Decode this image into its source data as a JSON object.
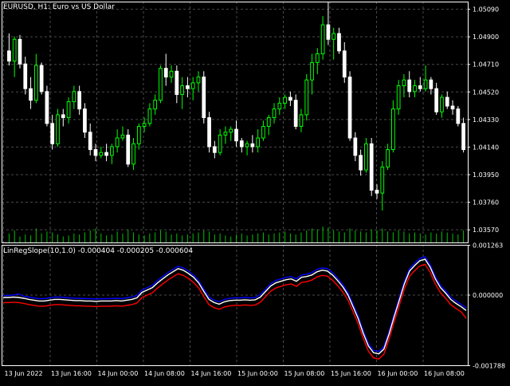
{
  "title": "EURUSD, H1:  Euro vs US Dollar",
  "indicator_label": "LinRegSlope(10,1.0) -0.000404 -0.000205 -0.000604",
  "colors": {
    "background": "#000000",
    "grid": "#4a4a4a",
    "candle_bull": "#00ff00",
    "candle_bear": "#ffffff",
    "volume": "#00c000",
    "line_main": "#ffffff",
    "line_upper": "#0000ff",
    "line_lower": "#ff0000",
    "text": "#ffffff"
  },
  "chart_data": [
    {
      "type": "candlestick",
      "title": "EURUSD, H1:  Euro vs US Dollar",
      "price_ticks": [
        "1.05090",
        "1.04900",
        "1.04710",
        "1.04520",
        "1.04330",
        "1.04140",
        "1.03950",
        "1.03760",
        "1.03570"
      ],
      "ylim": [
        1.0348,
        1.0514
      ],
      "grid": true,
      "x_ticks": [
        "13 Jun 2022",
        "13 Jun 16:00",
        "14 Jun 00:00",
        "14 Jun 08:00",
        "14 Jun 16:00",
        "15 Jun 00:00",
        "15 Jun 08:00",
        "15 Jun 16:00",
        "16 Jun 00:00",
        "16 Jun 08:00"
      ],
      "ohlc": [
        [
          1.048,
          1.0492,
          1.047,
          1.0473
        ],
        [
          1.0473,
          1.049,
          1.0462,
          1.0488
        ],
        [
          1.0488,
          1.0491,
          1.0468,
          1.0471
        ],
        [
          1.0471,
          1.0476,
          1.045,
          1.0454
        ],
        [
          1.0454,
          1.0462,
          1.044,
          1.0446
        ],
        [
          1.0446,
          1.0478,
          1.0444,
          1.047
        ],
        [
          1.047,
          1.0472,
          1.045,
          1.0452
        ],
        [
          1.0452,
          1.0456,
          1.0428,
          1.043
        ],
        [
          1.043,
          1.0436,
          1.0412,
          1.0416
        ],
        [
          1.0416,
          1.044,
          1.0414,
          1.0436
        ],
        [
          1.0436,
          1.044,
          1.0428,
          1.0434
        ],
        [
          1.0434,
          1.0448,
          1.043,
          1.0445
        ],
        [
          1.0445,
          1.0456,
          1.044,
          1.0452
        ],
        [
          1.0452,
          1.0456,
          1.0436,
          1.044
        ],
        [
          1.044,
          1.0444,
          1.042,
          1.0424
        ],
        [
          1.0424,
          1.043,
          1.0408,
          1.0412
        ],
        [
          1.0412,
          1.0416,
          1.0404,
          1.0408
        ],
        [
          1.0408,
          1.0414,
          1.0406,
          1.041
        ],
        [
          1.041,
          1.0416,
          1.0404,
          1.0408
        ],
        [
          1.0408,
          1.0416,
          1.0402,
          1.0414
        ],
        [
          1.0414,
          1.0426,
          1.041,
          1.042
        ],
        [
          1.042,
          1.0428,
          1.0418,
          1.0422
        ],
        [
          1.0422,
          1.0426,
          1.04,
          1.0402
        ],
        [
          1.0402,
          1.042,
          1.0398,
          1.0416
        ],
        [
          1.0416,
          1.043,
          1.0412,
          1.0428
        ],
        [
          1.0428,
          1.0434,
          1.0424,
          1.043
        ],
        [
          1.043,
          1.0444,
          1.0428,
          1.044
        ],
        [
          1.044,
          1.045,
          1.0436,
          1.0446
        ],
        [
          1.0446,
          1.047,
          1.0444,
          1.0468
        ],
        [
          1.0468,
          1.0478,
          1.0456,
          1.0462
        ],
        [
          1.0462,
          1.047,
          1.0458,
          1.0466
        ],
        [
          1.0466,
          1.047,
          1.0444,
          1.045
        ],
        [
          1.045,
          1.0462,
          1.044,
          1.0456
        ],
        [
          1.0456,
          1.0462,
          1.0448,
          1.0454
        ],
        [
          1.0454,
          1.0462,
          1.0446,
          1.0458
        ],
        [
          1.0458,
          1.0466,
          1.0452,
          1.0462
        ],
        [
          1.0462,
          1.0466,
          1.043,
          1.0434
        ],
        [
          1.0434,
          1.0438,
          1.041,
          1.0414
        ],
        [
          1.0414,
          1.0418,
          1.0406,
          1.041
        ],
        [
          1.041,
          1.0426,
          1.0408,
          1.0422
        ],
        [
          1.0422,
          1.0428,
          1.0416,
          1.0424
        ],
        [
          1.0424,
          1.0428,
          1.0418,
          1.0426
        ],
        [
          1.0426,
          1.0432,
          1.0414,
          1.0418
        ],
        [
          1.0418,
          1.042,
          1.041,
          1.0414
        ],
        [
          1.0414,
          1.0418,
          1.0408,
          1.0416
        ],
        [
          1.0416,
          1.0422,
          1.041,
          1.0414
        ],
        [
          1.0414,
          1.0426,
          1.041,
          1.042
        ],
        [
          1.042,
          1.0432,
          1.0418,
          1.0428
        ],
        [
          1.0428,
          1.0436,
          1.0422,
          1.0434
        ],
        [
          1.0434,
          1.0444,
          1.043,
          1.044
        ],
        [
          1.044,
          1.0448,
          1.0436,
          1.0444
        ],
        [
          1.0444,
          1.045,
          1.044,
          1.0448
        ],
        [
          1.0448,
          1.0452,
          1.0442,
          1.0446
        ],
        [
          1.0446,
          1.045,
          1.0426,
          1.0428
        ],
        [
          1.0428,
          1.044,
          1.0424,
          1.0436
        ],
        [
          1.0436,
          1.0464,
          1.0432,
          1.046
        ],
        [
          1.046,
          1.0478,
          1.045,
          1.0472
        ],
        [
          1.0472,
          1.0482,
          1.0464,
          1.0478
        ],
        [
          1.0478,
          1.0504,
          1.0474,
          1.0498
        ],
        [
          1.0498,
          1.0514,
          1.0484,
          1.0488
        ],
        [
          1.0488,
          1.0496,
          1.0474,
          1.0492
        ],
        [
          1.0492,
          1.0496,
          1.0478,
          1.048
        ],
        [
          1.048,
          1.0486,
          1.0458,
          1.0462
        ],
        [
          1.0462,
          1.0466,
          1.0418,
          1.042
        ],
        [
          1.042,
          1.0424,
          1.0404,
          1.0408
        ],
        [
          1.0408,
          1.0412,
          1.0394,
          1.0398
        ],
        [
          1.0398,
          1.042,
          1.0396,
          1.0416
        ],
        [
          1.0416,
          1.042,
          1.038,
          1.0384
        ],
        [
          1.0384,
          1.0388,
          1.0378,
          1.0382
        ],
        [
          1.0382,
          1.0404,
          1.037,
          1.04
        ],
        [
          1.04,
          1.0416,
          1.0398,
          1.0412
        ],
        [
          1.0412,
          1.0446,
          1.041,
          1.044
        ],
        [
          1.044,
          1.046,
          1.0436,
          1.0456
        ],
        [
          1.0456,
          1.0464,
          1.0448,
          1.046
        ],
        [
          1.046,
          1.0466,
          1.0448,
          1.0452
        ],
        [
          1.0452,
          1.046,
          1.0448,
          1.0456
        ],
        [
          1.0456,
          1.0462,
          1.0452,
          1.0454
        ],
        [
          1.0454,
          1.047,
          1.0452,
          1.046
        ],
        [
          1.046,
          1.0462,
          1.045,
          1.0454
        ],
        [
          1.0454,
          1.0458,
          1.0436,
          1.0438
        ],
        [
          1.0438,
          1.045,
          1.0434,
          1.0448
        ],
        [
          1.0448,
          1.0452,
          1.044,
          1.0442
        ],
        [
          1.0442,
          1.0446,
          1.0436,
          1.044
        ],
        [
          1.044,
          1.0442,
          1.0428,
          1.043
        ],
        [
          1.043,
          1.0434,
          1.041,
          1.0412
        ]
      ],
      "volume": [
        9,
        12,
        6,
        8,
        7,
        14,
        9,
        11,
        10,
        8,
        6,
        7,
        9,
        8,
        10,
        12,
        14,
        9,
        7,
        8,
        11,
        9,
        13,
        10,
        8,
        7,
        9,
        10,
        12,
        11,
        8,
        9,
        7,
        8,
        9,
        10,
        12,
        11,
        8,
        9,
        7,
        6,
        8,
        9,
        7,
        8,
        9,
        10,
        8,
        9,
        10,
        11,
        9,
        8,
        10,
        12,
        14,
        13,
        16,
        15,
        12,
        11,
        10,
        14,
        12,
        11,
        10,
        13,
        12,
        14,
        11,
        10,
        12,
        11,
        9,
        10,
        9,
        8,
        10,
        9,
        11,
        10,
        9,
        8,
        12
      ]
    },
    {
      "type": "line",
      "title": "LinRegSlope(10,1.0) -0.000404 -0.000205 -0.000604",
      "y_ticks": [
        "0.001263",
        "0.000000",
        "-0.001788"
      ],
      "ylim": [
        -0.001788,
        0.001263
      ],
      "series": [
        {
          "values": [
            -7e-05,
            -7e-05,
            -6e-05,
            -7e-05,
            -9e-05,
            -0.00012,
            -0.00014,
            -0.00016,
            -0.00016,
            -0.00014,
            -0.00012,
            -0.00012,
            -0.00013,
            -0.00014,
            -0.00015,
            -0.00015,
            -0.00016,
            -0.00016,
            -0.00017,
            -0.00016,
            -0.00016,
            -0.00016,
            -0.00015,
            -0.00016,
            -0.00014,
            -0.00012,
            -8e-05,
            6e-05,
            0.00012,
            0.00018,
            0.0003,
            0.0004,
            0.0005,
            0.00058,
            0.00066,
            0.00062,
            0.00054,
            0.00044,
            0.0003,
            8e-05,
            -0.00012,
            -0.0002,
            -0.00024,
            -0.00018,
            -0.00015,
            -0.00014,
            -0.00014,
            -0.00013,
            -0.00014,
            -0.00013,
            -6e-05,
            8e-05,
            0.00022,
            0.0003,
            0.00034,
            0.00038,
            0.0004,
            0.00034,
            0.00044,
            0.00046,
            0.0005,
            0.00058,
            0.00062,
            0.0006,
            0.0005,
            0.00036,
            0.0002,
            0.0,
            -0.0003,
            -0.0006,
            -0.00098,
            -0.0013,
            -0.00147,
            -0.0015,
            -0.00138,
            -0.001,
            -0.00056,
            -0.00014,
            0.00028,
            0.0006,
            0.00074,
            0.00086,
            0.0009,
            0.0007,
            0.0004,
            0.00018,
            4e-05,
            -0.00012,
            -0.00022,
            -0.0003,
            -0.0004
          ]
        },
        {
          "values": [
            -2e-05,
            -2e-05,
            -1e-05,
            2e-05,
            -4e-05,
            -6e-05,
            -8e-05,
            -0.0001,
            -0.0001,
            -8e-05,
            -6e-05,
            -6e-05,
            -7e-05,
            -8e-05,
            -9e-05,
            -9e-05,
            -0.0001,
            -0.0001,
            -0.00011,
            -0.0001,
            -0.0001,
            -0.0001,
            -9e-05,
            -0.0001,
            -8e-05,
            -6e-05,
            -2e-05,
            0.00012,
            0.00018,
            0.00024,
            0.00036,
            0.00046,
            0.00056,
            0.00064,
            0.00072,
            0.00068,
            0.0006,
            0.0005,
            0.00036,
            0.00014,
            -6e-05,
            -0.00014,
            -0.00018,
            -0.00012,
            -9e-05,
            -8e-05,
            -8e-05,
            -7e-05,
            -8e-05,
            -7e-05,
            0.0,
            0.00014,
            0.00028,
            0.00036,
            0.0004,
            0.00044,
            0.00046,
            0.0004,
            0.0005,
            0.00052,
            0.00056,
            0.00064,
            0.00068,
            0.00066,
            0.00056,
            0.00042,
            0.00026,
            6e-05,
            -0.00024,
            -0.00054,
            -0.00092,
            -0.00124,
            -0.00141,
            -0.00144,
            -0.00132,
            -0.00094,
            -0.0005,
            -8e-05,
            0.00034,
            0.00066,
            0.0008,
            0.00092,
            0.00096,
            0.00076,
            0.00046,
            0.00024,
            0.0001,
            -6e-05,
            -0.00016,
            -0.00024,
            -0.00034
          ]
        },
        {
          "values": [
            -0.0002,
            -0.0002,
            -0.00019,
            -0.0002,
            -0.00022,
            -0.00025,
            -0.00027,
            -0.00029,
            -0.00029,
            -0.00027,
            -0.00025,
            -0.00025,
            -0.00026,
            -0.00027,
            -0.00028,
            -0.00028,
            -0.00029,
            -0.00029,
            -0.0003,
            -0.00029,
            -0.00029,
            -0.00029,
            -0.00028,
            -0.00029,
            -0.00027,
            -0.00025,
            -0.00021,
            -7e-05,
            -1e-05,
            5e-05,
            0.00017,
            0.00027,
            0.00037,
            0.00045,
            0.00053,
            0.00049,
            0.00041,
            0.00031,
            0.00017,
            -5e-05,
            -0.00025,
            -0.00033,
            -0.00037,
            -0.00031,
            -0.00028,
            -0.00027,
            -0.00027,
            -0.00026,
            -0.00027,
            -0.00026,
            -0.00019,
            -5e-05,
            9e-05,
            0.00017,
            0.00021,
            0.00025,
            0.00027,
            0.00021,
            0.00031,
            0.00033,
            0.00037,
            0.00045,
            0.00049,
            0.00047,
            0.00037,
            0.00023,
            7e-05,
            -0.00013,
            -0.00043,
            -0.00073,
            -0.00111,
            -0.00143,
            -0.0016,
            -0.00163,
            -0.00151,
            -0.00113,
            -0.00069,
            -0.00027,
            0.00015,
            0.00047,
            0.00061,
            0.00073,
            0.00077,
            0.00057,
            0.00027,
            5e-05,
            -9e-05,
            -0.00025,
            -0.00035,
            -0.00043,
            -0.0006
          ]
        }
      ]
    }
  ]
}
